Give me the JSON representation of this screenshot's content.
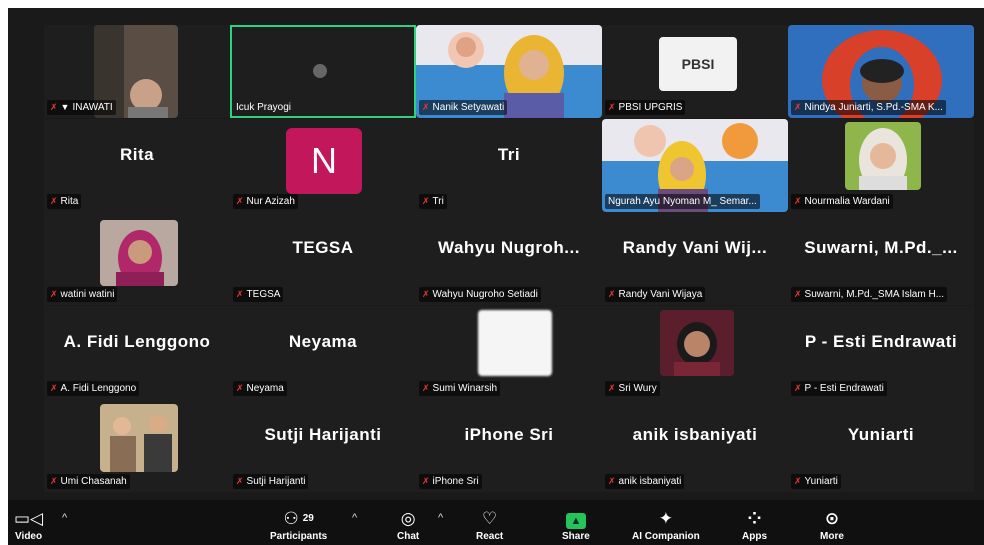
{
  "tiles": [
    {
      "big": "",
      "name": "INAWATI",
      "pinned": true
    },
    {
      "big": "",
      "name": "Icuk Prayogi"
    },
    {
      "big": "",
      "name": "Nanik Setyawati"
    },
    {
      "big": "",
      "name": "PBSI UPGRIS",
      "logo_text": "PBSI"
    },
    {
      "big": "",
      "name": "Nindya Juniarti, S.Pd.-SMA K..."
    },
    {
      "big": "Rita",
      "name": "Rita"
    },
    {
      "big": "",
      "name": "Nur Azizah",
      "avatar_letter": "N"
    },
    {
      "big": "Tri",
      "name": "Tri"
    },
    {
      "big": "",
      "name": "Ngurah Ayu Nyoman M_ Semar..."
    },
    {
      "big": "",
      "name": "Nourmalia Wardani"
    },
    {
      "big": "",
      "name": "watini watini"
    },
    {
      "big": "TEGSA",
      "name": "TEGSA"
    },
    {
      "big": "Wahyu  Nugroh...",
      "name": "Wahyu Nugroho Setiadi"
    },
    {
      "big": "Randy Vani Wij...",
      "name": "Randy Vani Wijaya"
    },
    {
      "big": "Suwarni,  M.Pd._...",
      "name": "Suwarni, M.Pd._SMA Islam H..."
    },
    {
      "big": "A. Fidi Lenggono",
      "name": "A. Fidi Lenggono"
    },
    {
      "big": "Neyama",
      "name": "Neyama"
    },
    {
      "big": "",
      "name": "Sumi Winarsih"
    },
    {
      "big": "",
      "name": "Sri Wury"
    },
    {
      "big": "P - Esti Endrawati",
      "name": "P - Esti Endrawati"
    },
    {
      "big": "",
      "name": "Umi Chasanah"
    },
    {
      "big": "Sutji Harijanti",
      "name": "Sutji Harijanti"
    },
    {
      "big": "iPhone Sri",
      "name": "iPhone Sri"
    },
    {
      "big": "anik isbaniyati",
      "name": "anik isbaniyati"
    },
    {
      "big": "Yuniarti",
      "name": "Yuniarti"
    }
  ],
  "toolbar": {
    "video": "Video",
    "participants": "Participants",
    "participants_count": "29",
    "chat": "Chat",
    "react": "React",
    "share": "Share",
    "ai": "AI Companion",
    "apps": "Apps",
    "more": "More"
  },
  "colors": {
    "active_border": "#2fd27f",
    "share": "#24c35c",
    "avatar": "#c2185b",
    "muted_mic": "#e53935"
  }
}
